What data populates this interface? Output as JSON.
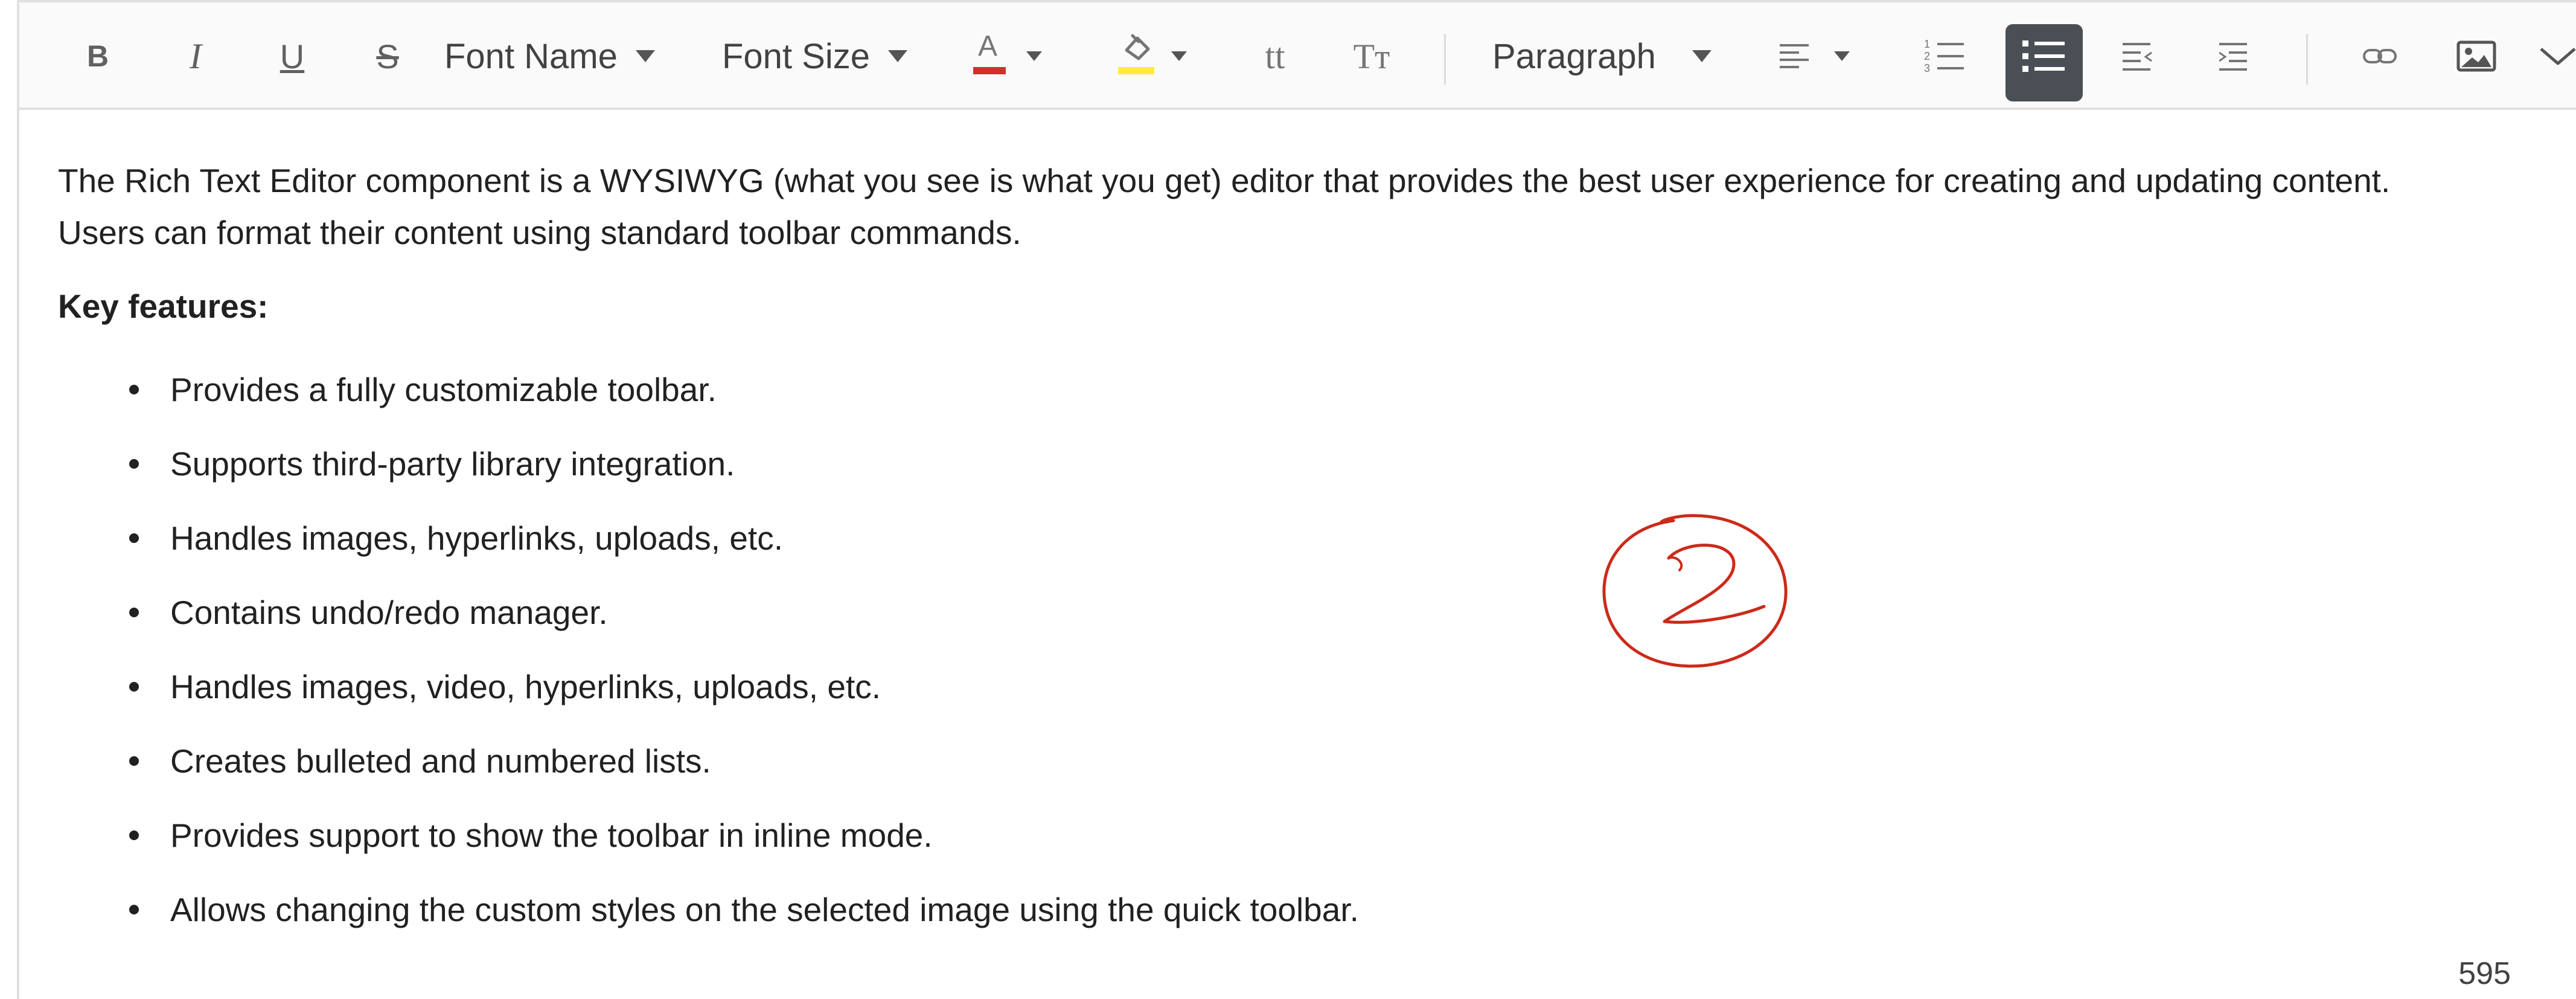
{
  "toolbar": {
    "bold_label": "B",
    "italic_label": "I",
    "underline_label": "U",
    "strike_label": "S",
    "font_name_label": "Font Name",
    "font_size_label": "Font Size",
    "font_color_letter": "A",
    "lowercase_label": "tt",
    "uppercase_label": "Tт",
    "format_label": "Paragraph",
    "icons": [
      "bold",
      "italic",
      "underline",
      "strikethrough",
      "font-name-dropdown",
      "font-size-dropdown",
      "font-color",
      "background-color",
      "lowercase",
      "uppercase",
      "paragraph-format-dropdown",
      "alignments-dropdown",
      "ordered-list",
      "unordered-list",
      "outdent",
      "indent",
      "link",
      "image",
      "expand-toolbar"
    ],
    "colors": {
      "font_color": "#d32f2f",
      "background_color": "#ffeb3b",
      "active_button": "#4a4f55"
    }
  },
  "content": {
    "intro_line1": "The Rich Text Editor component is a WYSIWYG (what you see is what you get) editor that provides the best user experience for creating and updating content.",
    "intro_line2": "Users can format their content using standard toolbar commands.",
    "key_features_heading": "Key features:",
    "features": [
      "Provides a fully customizable toolbar.",
      "Supports third-party library integration.",
      "Handles images, hyperlinks, uploads, etc.",
      "Contains undo/redo manager.",
      "Handles images, video, hyperlinks, uploads, etc.",
      "Creates bulleted and numbered lists.",
      "Provides support to show the toolbar in inline mode.",
      "Allows changing the custom styles on the selected image using the quick toolbar."
    ]
  },
  "status": {
    "char_count": "595"
  },
  "annotation": {
    "color": "#cc2a1a"
  }
}
